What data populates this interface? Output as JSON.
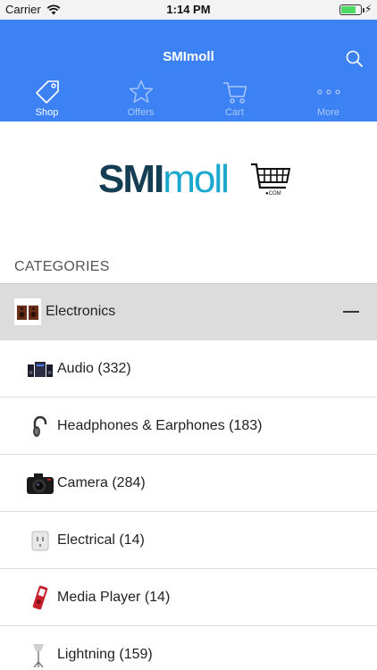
{
  "status_bar": {
    "carrier": "Carrier",
    "time": "1:14 PM",
    "battery_level": 0.75,
    "battery_color": "#4cd964"
  },
  "header": {
    "title": "SMImoll",
    "background": "#3d82f5",
    "search_icon": "search-icon"
  },
  "tabs": [
    {
      "label": "Shop",
      "icon": "tag-icon",
      "active": true
    },
    {
      "label": "Offers",
      "icon": "star-icon",
      "active": false
    },
    {
      "label": "Cart",
      "icon": "cart-icon",
      "active": false
    },
    {
      "label": "More",
      "icon": "more-dots-icon",
      "active": false
    }
  ],
  "logo": {
    "part1": "SMI",
    "part2": "moll",
    "suffix": "●COM",
    "colors": {
      "dark": "#153e55",
      "light": "#19a6cf"
    }
  },
  "categories": {
    "heading": "CATEGORIES",
    "parent": {
      "name": "Electronics",
      "expanded": true,
      "icon": "speakers-thumbnail"
    },
    "items": [
      {
        "label": "Audio (332)",
        "icon": "audio-system-thumbnail"
      },
      {
        "label": "Headphones & Earphones (183)",
        "icon": "headphones-thumbnail"
      },
      {
        "label": "Camera (284)",
        "icon": "camera-thumbnail"
      },
      {
        "label": "Electrical (14)",
        "icon": "socket-thumbnail"
      },
      {
        "label": "Media Player (14)",
        "icon": "media-player-thumbnail"
      },
      {
        "label": "Lightning (159)",
        "icon": "lamp-thumbnail"
      }
    ]
  }
}
